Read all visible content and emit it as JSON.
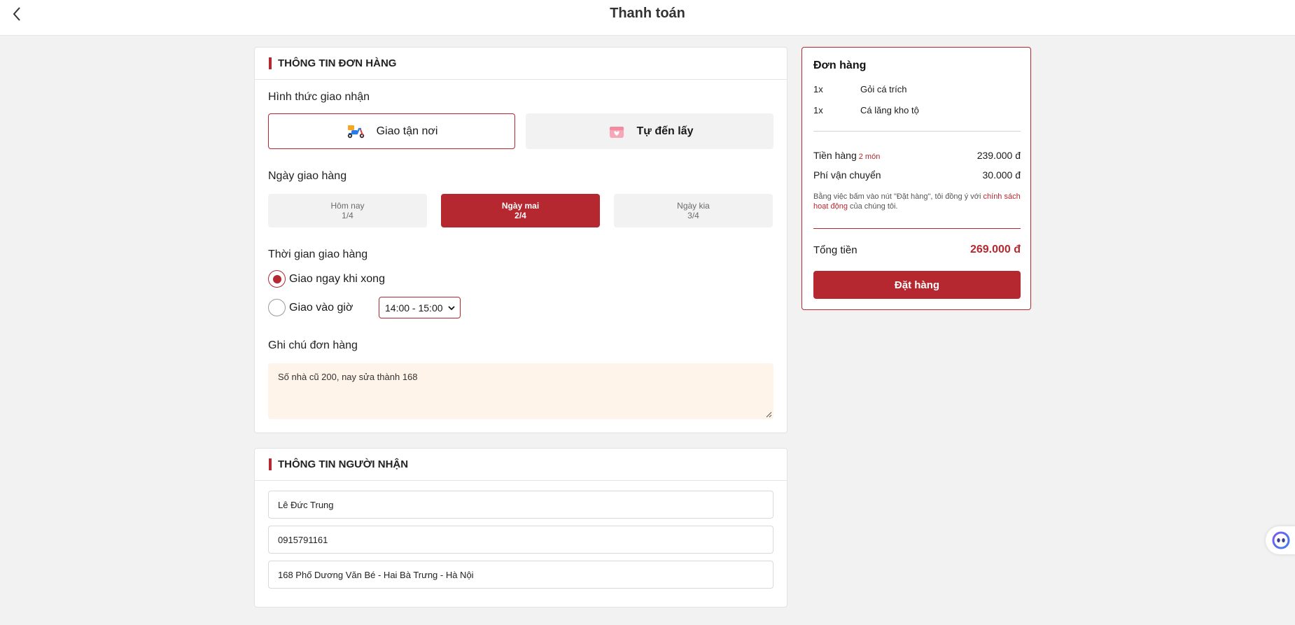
{
  "header": {
    "title": "Thanh toán",
    "back_icon": "chevron-left-icon"
  },
  "order_info": {
    "section_title": "THÔNG TIN ĐƠN HÀNG",
    "delivery_method": {
      "label": "Hình thức giao nhận",
      "options": [
        {
          "label": "Giao tận nơi",
          "icon": "scooter-icon",
          "selected": true
        },
        {
          "label": "Tự đến lấy",
          "icon": "gift-box-icon",
          "selected": false
        }
      ]
    },
    "delivery_date": {
      "label": "Ngày giao hàng",
      "options": [
        {
          "day": "Hôm nay",
          "date": "1/4",
          "selected": false
        },
        {
          "day": "Ngày mai",
          "date": "2/4",
          "selected": true
        },
        {
          "day": "Ngày kia",
          "date": "3/4",
          "selected": false
        }
      ]
    },
    "delivery_time": {
      "label": "Thời gian giao hàng",
      "options": [
        {
          "label": "Giao ngay khi xong",
          "selected": true
        },
        {
          "label": "Giao vào giờ",
          "selected": false
        }
      ],
      "time_slot": "14:00 - 15:00"
    },
    "note": {
      "label": "Ghi chú đơn hàng",
      "value": "Số nhà cũ 200, nay sửa thành 168"
    }
  },
  "recipient": {
    "section_title": "THÔNG TIN NGƯỜI NHẬN",
    "name": "Lê Đức Trung",
    "phone": "0915791161",
    "address": "168 Phố Dương Văn Bé - Hai Bà Trưng - Hà Nội"
  },
  "summary": {
    "title": "Đơn hàng",
    "items": [
      {
        "qty": "1x",
        "name": "Gỏi cá trích"
      },
      {
        "qty": "1x",
        "name": "Cá lăng kho tộ"
      }
    ],
    "subtotal_label": "Tiền hàng",
    "item_count": "2 món",
    "subtotal": "239.000 đ",
    "shipping_label": "Phí vận chuyển",
    "shipping": "30.000 đ",
    "terms_prefix": "Bằng việc bấm vào nút \"Đặt hàng\", tôi đồng ý với",
    "terms_link": "chính sách hoạt động",
    "terms_suffix": "của chúng tôi.",
    "total_label": "Tổng tiền",
    "total": "269.000 đ",
    "order_button": "Đặt hàng"
  },
  "colors": {
    "accent": "#b52830",
    "note_bg": "#fff4ea",
    "page_bg": "#f2f2f2"
  },
  "chat_widget": {
    "icon": "chatbot-icon"
  }
}
